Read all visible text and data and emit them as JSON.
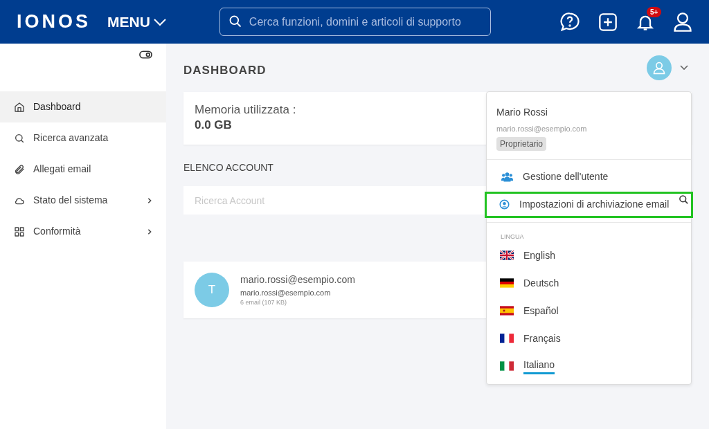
{
  "header": {
    "logo": "IONOS",
    "menu": "MENU",
    "search": {
      "placeholder": "Cerca funzioni, domini e articoli di supporto"
    },
    "notification_badge": "5+"
  },
  "sidebar": {
    "items": [
      {
        "kind": "home",
        "label": "Dashboard",
        "selected": true,
        "expandable": false
      },
      {
        "kind": "search",
        "label": "Ricerca avanzata",
        "selected": false,
        "expandable": false
      },
      {
        "kind": "clip",
        "label": "Allegati email",
        "selected": false,
        "expandable": false
      },
      {
        "kind": "cloud",
        "label": "Stato del sistema",
        "selected": false,
        "expandable": true
      },
      {
        "kind": "grid",
        "label": "Conformità",
        "selected": false,
        "expandable": true
      }
    ]
  },
  "main": {
    "title": "DASHBOARD",
    "storage": {
      "label": "Memoria utilizzata :",
      "value": "0.0 GB"
    },
    "accounts_heading": "ELENCO ACCOUNT",
    "account_search": {
      "placeholder": "Ricerca Account"
    },
    "accounts": [
      {
        "avatar": "T",
        "name": "mario.rossi@esempio.com",
        "email": "mario.rossi@esempio.com",
        "info": "6 email (107 KB)"
      }
    ]
  },
  "user_menu": {
    "name": "Mario Rossi",
    "email": "mario.rossi@esempio.com",
    "role": "Proprietario",
    "items": [
      {
        "kind": "users",
        "label": "Gestione dell'utente",
        "highlighted": false
      },
      {
        "kind": "user",
        "label": "Impostazioni di archiviazione email",
        "highlighted": true
      }
    ],
    "language_heading": "LINGUA",
    "languages": [
      {
        "kind": "uk",
        "label": "English",
        "selected": false
      },
      {
        "kind": "de",
        "label": "Deutsch",
        "selected": false
      },
      {
        "kind": "es",
        "label": "Español",
        "selected": false
      },
      {
        "kind": "fr",
        "label": "Français",
        "selected": false
      },
      {
        "kind": "it",
        "label": "Italiano",
        "selected": true
      }
    ]
  }
}
